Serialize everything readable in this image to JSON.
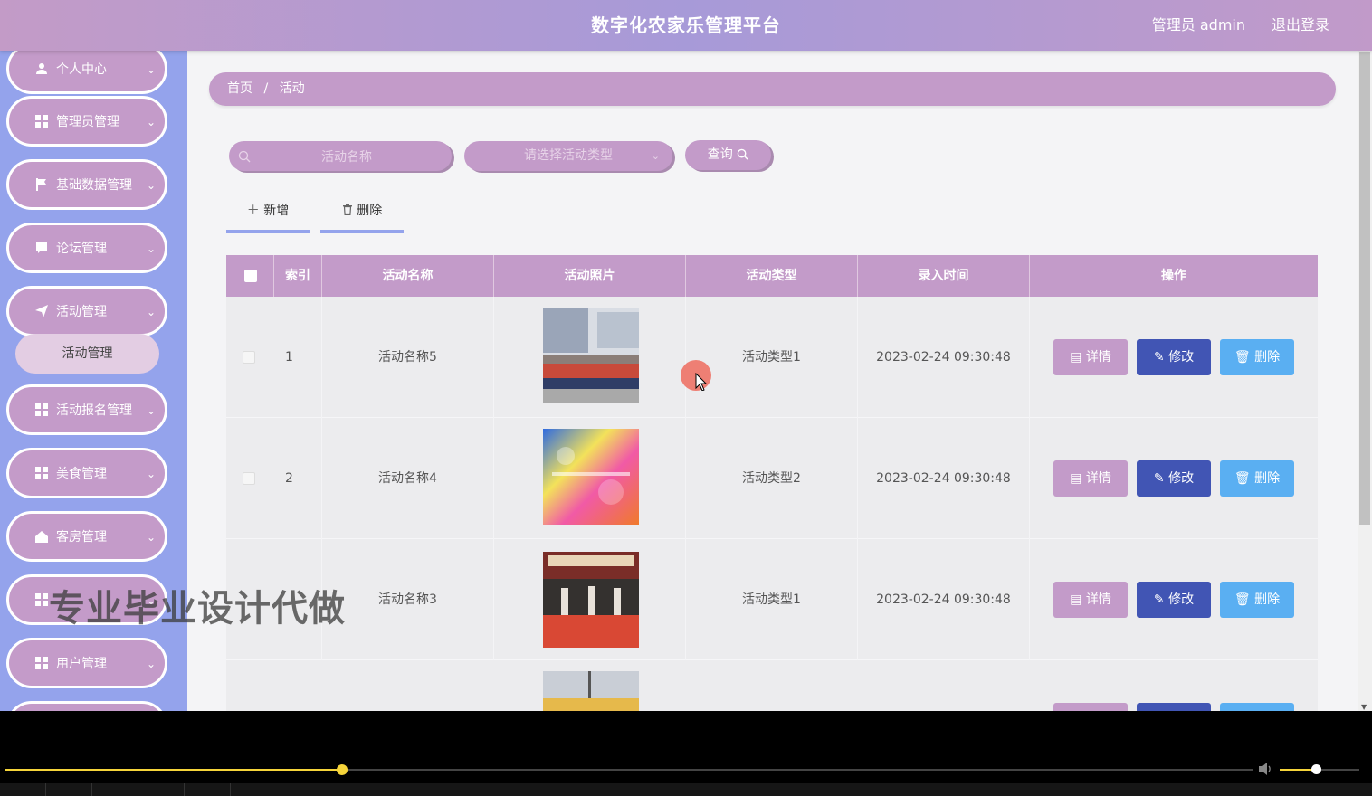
{
  "header": {
    "title": "数字化农家乐管理平台",
    "user": "管理员 admin",
    "logout": "退出登录"
  },
  "sidebar": {
    "items": [
      {
        "label": "个人中心",
        "icon": "user-icon"
      },
      {
        "label": "管理员管理",
        "icon": "grid-icon"
      },
      {
        "label": "基础数据管理",
        "icon": "flag-icon"
      },
      {
        "label": "论坛管理",
        "icon": "chat-icon"
      },
      {
        "label": "活动管理",
        "icon": "send-icon"
      },
      {
        "label": "活动报名管理",
        "icon": "grid-icon"
      },
      {
        "label": "美食管理",
        "icon": "grid-icon"
      },
      {
        "label": "客房管理",
        "icon": "house-icon"
      },
      {
        "label": "",
        "icon": "grid-icon"
      },
      {
        "label": "用户管理",
        "icon": "grid-icon"
      }
    ],
    "submenu": "活动管理",
    "chevron": "⌄"
  },
  "breadcrumb": {
    "home": "首页",
    "separator": "/",
    "current": "活动"
  },
  "search": {
    "name_placeholder": "活动名称",
    "type_placeholder": "请选择活动类型",
    "query_label": "查询"
  },
  "actions": {
    "add_label": "新增",
    "delete_label": "删除"
  },
  "table": {
    "headers": [
      "索引",
      "活动名称",
      "活动照片",
      "活动类型",
      "录入时间",
      "操作"
    ],
    "rows": [
      {
        "index": "1",
        "name": "活动名称5",
        "type": "活动类型1",
        "time": "2023-02-24 09:30:48"
      },
      {
        "index": "2",
        "name": "活动名称4",
        "type": "活动类型2",
        "time": "2023-02-24 09:30:48"
      },
      {
        "index": "",
        "name": "活动名称3",
        "type": "活动类型1",
        "time": "2023-02-24 09:30:48"
      },
      {
        "index": "",
        "name": "",
        "type": "",
        "time": ""
      }
    ],
    "op_detail": "详情",
    "op_edit": "修改",
    "op_delete": "删除"
  },
  "watermark": "专业毕业设计代做",
  "player": {
    "progress": 0.27,
    "volume": 0.45
  },
  "colors": {
    "accent": "#c39bc9",
    "sidebar": "#94a3ec",
    "edit": "#4155b4",
    "delete": "#5aaff2"
  }
}
